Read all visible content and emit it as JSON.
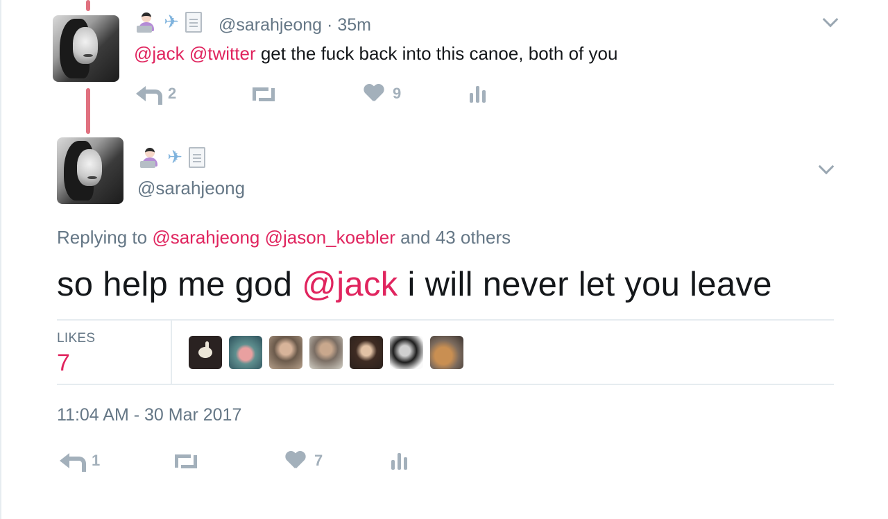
{
  "tweet1": {
    "handle": "@sarahjeong",
    "time": "· 35m",
    "mention1": "@jack",
    "mention2": "@twitter",
    "text": " get the fuck back into this canoe, both of you",
    "reply_count": "2",
    "like_count": "9"
  },
  "tweet2": {
    "handle": "@sarahjeong",
    "replying_prefix": "Replying to ",
    "replying_user1": "@sarahjeong",
    "replying_user2": "@jason_koebler",
    "replying_suffix": " and 43 others",
    "text_before": "so help me god ",
    "text_mention": "@jack",
    "text_after": " i will never let you leave",
    "likes_label": "LIKES",
    "likes_count": "7",
    "timestamp": "11:04 AM - 30 Mar 2017",
    "reply_count": "1",
    "like_count": "7"
  },
  "icons": [
    "technologist-emoji",
    "airplane-emoji",
    "document-emoji",
    "reply-icon",
    "retweet-icon",
    "heart-icon",
    "stats-icon",
    "chevron-down-icon"
  ],
  "colors": {
    "mention": "#e0245e",
    "thread_line": "#e0717f",
    "secondary_text": "#657786",
    "action_icon": "#a3b0bb"
  }
}
